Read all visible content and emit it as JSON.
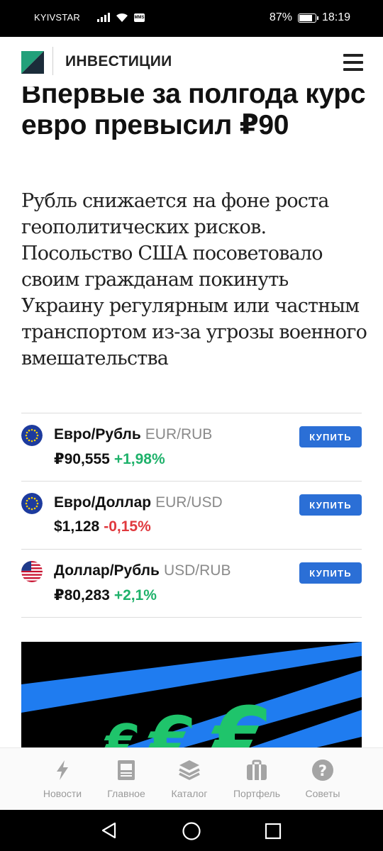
{
  "status_bar": {
    "carrier": "KYIVSTAR",
    "sms_badge": "MMS",
    "battery": "87%",
    "battery_level": 0.87,
    "time": "18:19"
  },
  "header": {
    "section": "ИНВЕСТИЦИИ",
    "logo_colors": [
      "#22a07a",
      "#1b2c3a"
    ]
  },
  "article": {
    "headline": "Впервые за полгода курс евро превысил ₽90",
    "lead": "Рубль снижается на фоне роста геополитических рисков. Посольство США посоветовало своим гражданам покинуть Украину регулярным или частным транспортом из-за угрозы военного вмешательства"
  },
  "quotes": [
    {
      "name": "Евро/Рубль",
      "ticker": "EUR/RUB",
      "price": "₽90,555",
      "change": "+1,98%",
      "direction": "up",
      "flag": "eu-flag-icon",
      "buy": "КУПИТЬ"
    },
    {
      "name": "Евро/Доллар",
      "ticker": "EUR/USD",
      "price": "$1,128",
      "change": "-0,15%",
      "direction": "down",
      "flag": "eu-flag-icon",
      "buy": "КУПИТЬ"
    },
    {
      "name": "Доллар/Рубль",
      "ticker": "USD/RUB",
      "price": "₽80,283",
      "change": "+2,1%",
      "direction": "up",
      "flag": "us-flag-icon",
      "buy": "КУПИТЬ"
    }
  ],
  "colors": {
    "up": "#1fb26b",
    "down": "#e0393e",
    "buy_button": "#2b6fd6",
    "banner_stripe": "#1f7cf0",
    "banner_symbol": "#1fc46b"
  },
  "bottom_nav": [
    {
      "label": "Новости",
      "icon": "lightning-icon"
    },
    {
      "label": "Главное",
      "icon": "newspaper-icon"
    },
    {
      "label": "Каталог",
      "icon": "layers-icon"
    },
    {
      "label": "Портфель",
      "icon": "briefcase-icon"
    },
    {
      "label": "Советы",
      "icon": "question-icon"
    }
  ]
}
